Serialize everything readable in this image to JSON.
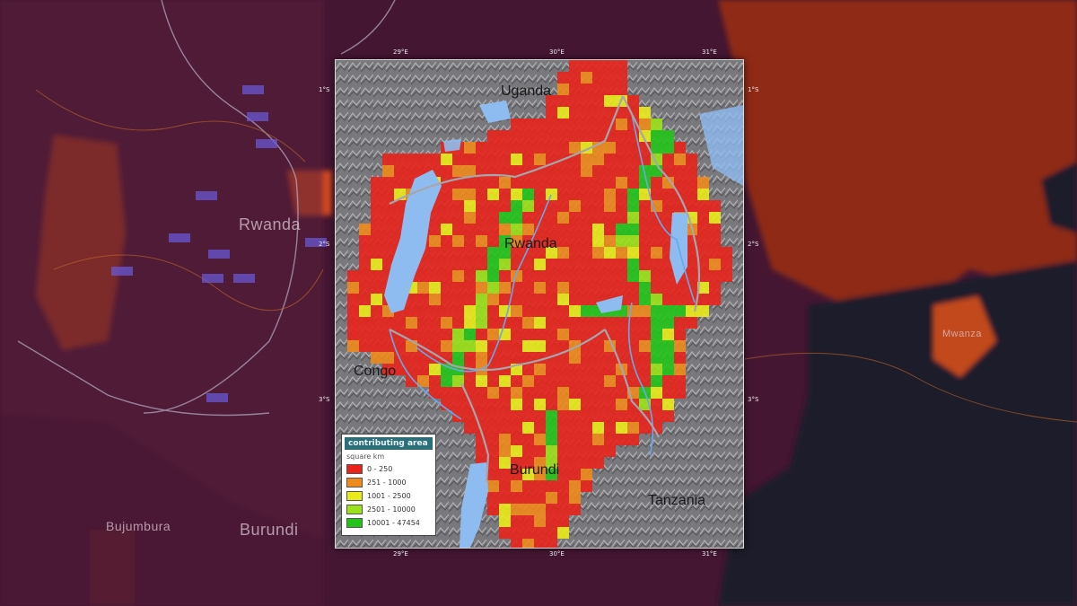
{
  "background": {
    "labels": {
      "rwanda": "Rwanda",
      "burundi": "Burundi",
      "bujumbura": "Bujumbura",
      "mwanza": "Mwanza"
    }
  },
  "map": {
    "countries": {
      "uganda": "Uganda",
      "rwanda": "Rwanda",
      "congo": "Congo",
      "burundi": "Burundi",
      "tanzania": "Tanzania"
    },
    "top_ticks": [
      "29°E",
      "30°E",
      "31°E"
    ],
    "bottom_ticks": [
      "29°E",
      "30°E",
      "31°E"
    ],
    "left_ticks": [
      "1°S",
      "2°S",
      "3°S"
    ],
    "right_ticks": [
      "1°S",
      "2°S",
      "3°S"
    ]
  },
  "legend": {
    "title": "contributing area",
    "unit": "square km",
    "items": [
      {
        "label": "0 - 250",
        "color": "#e8231c"
      },
      {
        "label": "251 - 1000",
        "color": "#f08a1c"
      },
      {
        "label": "1001 - 2500",
        "color": "#eaea1a"
      },
      {
        "label": "2501 - 10000",
        "color": "#9be21a"
      },
      {
        "label": "10001 - 47454",
        "color": "#22c41a"
      }
    ]
  },
  "colors": {
    "lake": "#8fbcf0",
    "river": "#6aa8e8",
    "border": "#9a9aa0",
    "background_tan": "#8a2a18"
  }
}
